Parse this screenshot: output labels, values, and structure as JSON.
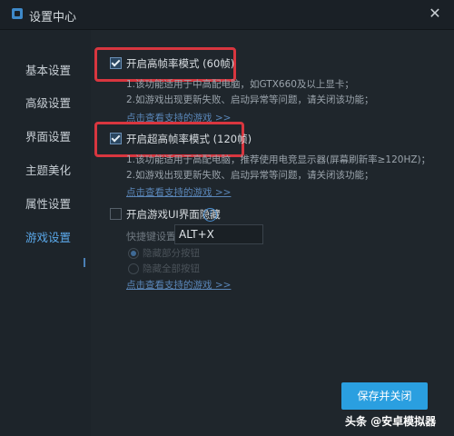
{
  "window": {
    "title": "设置中心",
    "close_glyph": "✕"
  },
  "sidebar": {
    "items": [
      {
        "label": "基本设置"
      },
      {
        "label": "高级设置"
      },
      {
        "label": "界面设置"
      },
      {
        "label": "主题美化"
      },
      {
        "label": "属性设置"
      },
      {
        "label": "游戏设置",
        "active": true
      }
    ]
  },
  "high_fps": {
    "label": "开启高帧率模式 (60帧)",
    "checked": true,
    "desc1": "1.该功能适用于中高配电脑，如GTX660及以上显卡；",
    "desc2": "2.如游戏出现更新失败、启动异常等问题，请关闭该功能；",
    "link": "点击查看支持的游戏 >>"
  },
  "ultra_fps": {
    "label": "开启超高帧率模式 (120帧)",
    "checked": true,
    "desc1": "1.该功能适用于高配电脑，推荐使用电竞显示器(屏幕刷新率≥120HZ)；",
    "desc2": "2.如游戏出现更新失败、启动异常等问题，请关闭该功能；",
    "link": "点击查看支持的游戏 >>"
  },
  "ui_hide": {
    "label": "开启游戏UI界面隐藏",
    "checked": false,
    "help_glyph": "?",
    "shortcut_label": "快捷键设置",
    "shortcut_value": "ALT+X",
    "radio1": "隐藏部分按钮",
    "radio2": "隐藏全部按钮",
    "link": "点击查看支持的游戏 >>"
  },
  "save_button": "保存并关闭",
  "watermark": "头条 @安卓模拟器",
  "colors": {
    "accent": "#2a9fe0",
    "highlight": "#d8363f",
    "active_nav": "#5aa7e8"
  }
}
